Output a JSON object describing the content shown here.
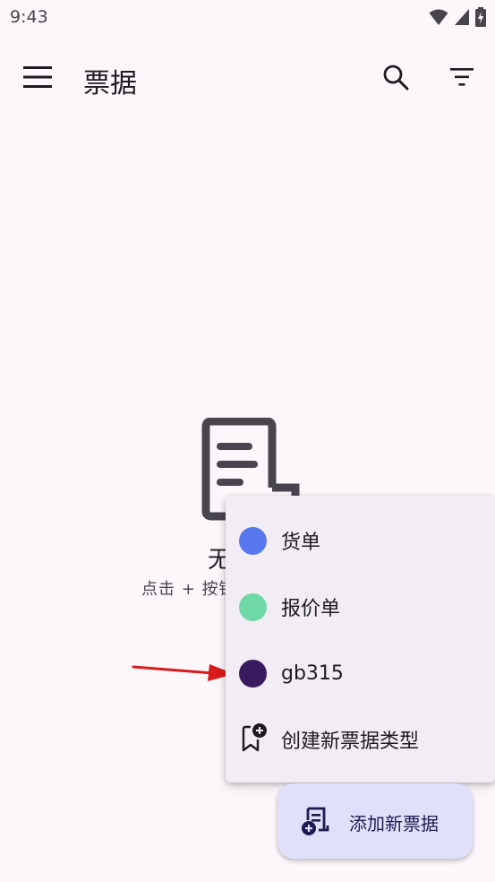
{
  "status_bar": {
    "time": "9:43"
  },
  "app_bar": {
    "title": "票据",
    "menu_icon": "hamburger-menu-icon",
    "search_icon": "search-icon",
    "filter_icon": "filter-icon"
  },
  "empty_state": {
    "icon": "receipt-icon",
    "title_visible": "无",
    "hint_visible": "点击 + 按钮"
  },
  "dropdown": {
    "items": [
      {
        "label": "货单",
        "color": "#5978f0"
      },
      {
        "label": "报价单",
        "color": "#6ed9a7"
      },
      {
        "label": "gb315",
        "color": "#3a1a5e"
      },
      {
        "label": "创建新票据类型",
        "icon": "bookmark-add-icon"
      }
    ]
  },
  "fab": {
    "label": "添加新票据",
    "icon": "add-receipt-icon"
  },
  "colors": {
    "background": "#fdf7fb",
    "menu_surface": "#f2edf4",
    "fab_container": "#e0e0fb",
    "annotation_arrow": "#d81b1b"
  }
}
